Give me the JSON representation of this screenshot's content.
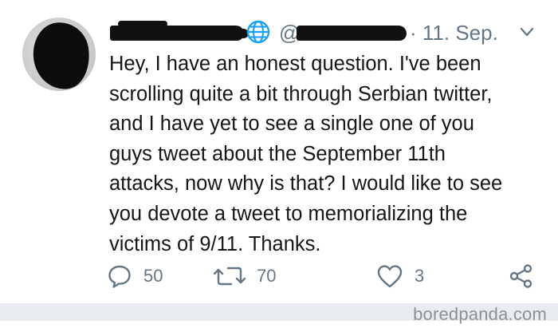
{
  "tweet": {
    "handle_prefix": "@",
    "date": "· 11. Sep.",
    "lines": [
      "Hey, I have an honest question. I've been",
      "scrolling quite a bit through Serbian twitter,",
      "and I have yet to see a single one of you",
      "guys tweet about the September 11th",
      "attacks, now why is that? I would like to see",
      "you devote a tweet to memorializing the",
      "victims of 9/11. Thanks."
    ],
    "actions": {
      "replies": "50",
      "retweets": "70",
      "likes": "3"
    }
  },
  "watermark": "boredpanda.com",
  "colors": {
    "text": "#14171a",
    "muted": "#657786",
    "link_blue": "#1da1f2",
    "footer_bar": "#e9edf1"
  },
  "icons": {
    "globe": "globe-icon",
    "chevron": "chevron-down-icon",
    "reply": "reply-icon",
    "retweet": "retweet-icon",
    "like": "heart-icon",
    "share": "share-icon"
  }
}
